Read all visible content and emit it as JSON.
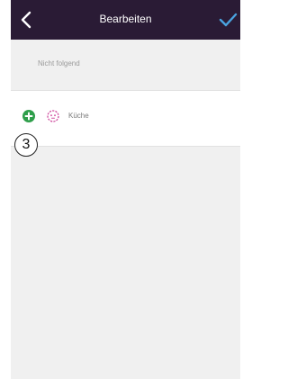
{
  "header": {
    "title": "Bearbeiten",
    "background": "#2a1b35",
    "confirm_color": "#4aa3df"
  },
  "section": {
    "label": "Nicht folgend"
  },
  "rooms": [
    {
      "label": "Küche",
      "icon": "outlet-icon",
      "action_icon": "add-circle-icon"
    }
  ],
  "annotation": {
    "marker": "3"
  },
  "colors": {
    "add": "#2e9e4a",
    "room_icon": "#d04fa0"
  }
}
